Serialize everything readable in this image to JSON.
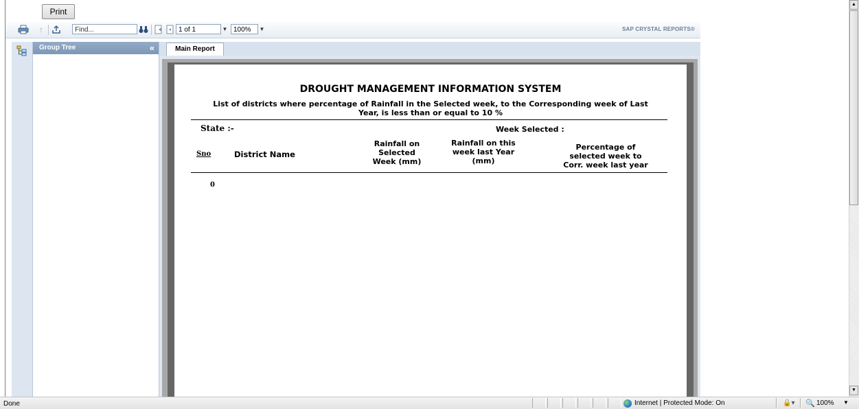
{
  "print_button": {
    "label": "Print"
  },
  "toolbar": {
    "find_placeholder": "Find...",
    "page_indicator": "1 of 1",
    "zoom_value": "100%",
    "brand": "SAP CRYSTAL REPORTS®"
  },
  "sidebar": {
    "title": "Group Tree",
    "collapse_glyph": "«"
  },
  "tabs": [
    {
      "label": "Main Report"
    }
  ],
  "report": {
    "title": "DROUGHT MANAGEMENT INFORMATION SYSTEM",
    "subtitle_line1": "List of districts where percentage of Rainfall in the Selected week, to the Corresponding week of Last",
    "subtitle_line2": "Year,  is less than or equal to 10 %",
    "state_label": "State :-",
    "week_label": "Week Selected :",
    "columns": {
      "sno": "Sno",
      "district": "District Name",
      "rain_selected": [
        "Rainfall on",
        "Selected",
        "Week (mm)"
      ],
      "rain_last_year": [
        "Rainfall on this",
        "week last Year",
        "(mm)"
      ],
      "percentage": [
        "Percentage of",
        "selected week to",
        "Corr. week last year"
      ]
    },
    "rows": [
      {
        "sno": "0"
      }
    ]
  },
  "statusbar": {
    "status": "Done",
    "zone": "Internet | Protected Mode: On",
    "zoom": "100%"
  },
  "icons": [
    "printer-icon",
    "up-arrow-icon",
    "export-icon",
    "binoculars-icon",
    "first-page-icon",
    "prev-page-icon",
    "group-tree-icon",
    "globe-icon",
    "lock-icon",
    "zoom-icon"
  ]
}
